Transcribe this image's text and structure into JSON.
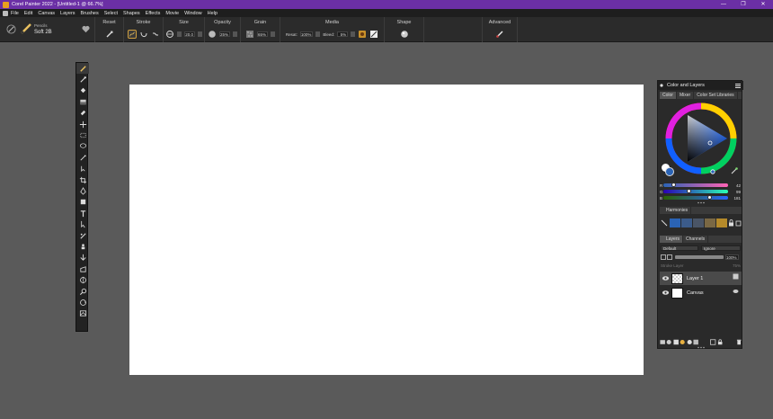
{
  "window": {
    "title": "Corel Painter 2022 - [Untitled-1 @ 66.7%]",
    "controls": [
      "—",
      "❐",
      "✕"
    ]
  },
  "menu": [
    "File",
    "Edit",
    "Canvas",
    "Layers",
    "Brushes",
    "Select",
    "Shapes",
    "Effects",
    "Movie",
    "Window",
    "Help"
  ],
  "brush": {
    "category": "Pencils",
    "variant": "Soft 2B"
  },
  "propbar": {
    "reset": "Reset",
    "stroke": "Stroke",
    "size": {
      "label": "Size",
      "value": "20.0"
    },
    "opacity": {
      "label": "Opacity",
      "value": "25%"
    },
    "grain": {
      "label": "Grain",
      "value": "65%"
    },
    "media": {
      "label": "Media",
      "resat_label": "Resat:",
      "resat_value": "100%",
      "bleed_label": "Bleed:",
      "bleed_value": "5%"
    },
    "shape": "Shape",
    "advanced": "Advanced"
  },
  "color_panel": {
    "title": "Color and Layers",
    "tabs": [
      "Color",
      "Mixer",
      "Color Set Libraries"
    ],
    "rgb": [
      {
        "label": "R",
        "value": "42",
        "fraction": 0.16
      },
      {
        "label": "G",
        "value": "99",
        "fraction": 0.39
      },
      {
        "label": "B",
        "value": "181",
        "fraction": 0.71
      }
    ],
    "main_color": "#2a63b5",
    "harmonies_title": "Harmonies",
    "harmony_swatches": [
      "#2a63b5",
      "#3b5b8a",
      "#4a5566",
      "#7a6844",
      "#b58a2a"
    ]
  },
  "layers_panel": {
    "tabs": [
      "Layers",
      "Channels"
    ],
    "composite_method": "Default",
    "composite_depth": "Ignore",
    "opacity_value": "100%",
    "stroke_layer_label": "Stroke Layer",
    "stroke_layer_value": "75%",
    "layers": [
      {
        "name": "Layer 1",
        "selected": true
      },
      {
        "name": "Canvas",
        "selected": false
      }
    ]
  }
}
